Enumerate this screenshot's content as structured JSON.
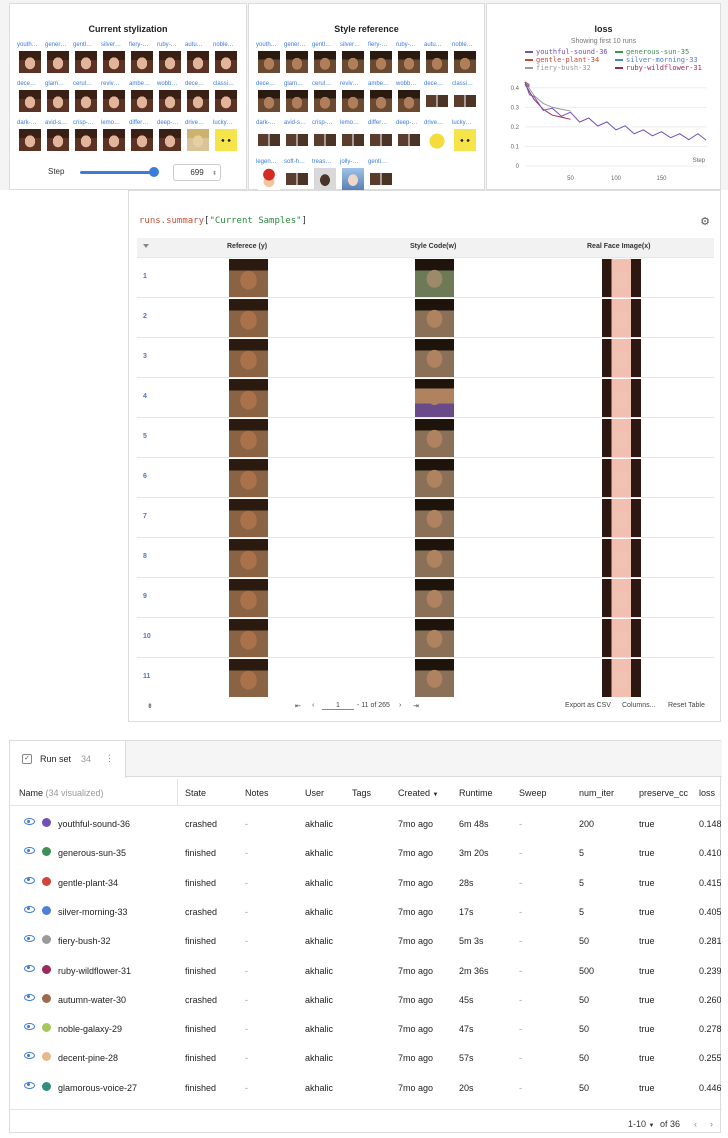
{
  "stylization_panel": {
    "title": "Current stylization",
    "thumb_captions": [
      "youth…",
      "gener…",
      "gentl…",
      "silver…",
      "fiery-…",
      "ruby-…",
      "autu…",
      "noble…",
      "dece…",
      "glam…",
      "cerul…",
      "reviv…",
      "ambe…",
      "wobb…",
      "dece…",
      "classi…",
      "dark-…",
      "avid-s…",
      "crisp-…",
      "lemo…",
      "differ…",
      "deep-…",
      "drive…",
      "lucky…"
    ],
    "step_label": "Step",
    "step_value": "699",
    "step_fraction": 0.92
  },
  "style_ref_panel": {
    "title": "Style reference",
    "thumb_captions": [
      "youth…",
      "gener…",
      "gentl…",
      "silver…",
      "fiery-…",
      "ruby-…",
      "autu…",
      "noble…",
      "dece…",
      "glam…",
      "cerul…",
      "reviv…",
      "ambe…",
      "wobb…",
      "dece…",
      "classi…",
      "dark-…",
      "avid-s…",
      "crisp-…",
      "lemo…",
      "differ…",
      "deep-…",
      "drive…",
      "lucky…",
      "legen…",
      "soft-h…",
      "treas…",
      "jolly-…",
      "genti…"
    ]
  },
  "loss_panel": {
    "title": "loss",
    "subtitle": "Showing first 10 runs",
    "legend": [
      {
        "name": "youthful-sound-36",
        "color": "#6f52b8"
      },
      {
        "name": "generous-sun-35",
        "color": "#3f8f56"
      },
      {
        "name": "gentle-plant-34",
        "color": "#d0443a"
      },
      {
        "name": "silver-morning-33",
        "color": "#4f7fd6"
      },
      {
        "name": "fiery-bush-32",
        "color": "#9a9a9a"
      },
      {
        "name": "ruby-wildflower-31",
        "color": "#9b2a5a"
      }
    ]
  },
  "chart_data": {
    "type": "line",
    "title": "loss",
    "xlabel": "Step",
    "ylabel": "",
    "xlim": [
      0,
      200
    ],
    "ylim": [
      0,
      0.45
    ],
    "x_ticks": [
      50,
      100,
      150
    ],
    "y_ticks": [
      0,
      0.1,
      0.2,
      0.3,
      0.4
    ],
    "series": [
      {
        "name": "youthful-sound-36",
        "x": [
          0,
          5,
          10,
          20,
          30,
          40,
          50,
          60,
          70,
          80,
          90,
          100,
          110,
          120,
          130,
          140,
          150,
          160,
          170,
          180,
          190,
          199
        ],
        "values": [
          0.43,
          0.38,
          0.34,
          0.3,
          0.28,
          0.27,
          0.26,
          0.24,
          0.23,
          0.22,
          0.21,
          0.2,
          0.19,
          0.18,
          0.17,
          0.17,
          0.16,
          0.16,
          0.15,
          0.15,
          0.15,
          0.148
        ]
      },
      {
        "name": "generous-sun-35",
        "x": [
          0,
          5
        ],
        "values": [
          0.42,
          0.41
        ]
      },
      {
        "name": "gentle-plant-34",
        "x": [
          0,
          5
        ],
        "values": [
          0.43,
          0.415
        ]
      },
      {
        "name": "silver-morning-33",
        "x": [
          0,
          5
        ],
        "values": [
          0.41,
          0.405
        ]
      },
      {
        "name": "fiery-bush-32",
        "x": [
          0,
          10,
          20,
          30,
          40,
          50
        ],
        "values": [
          0.43,
          0.36,
          0.32,
          0.3,
          0.29,
          0.281
        ]
      },
      {
        "name": "ruby-wildflower-31",
        "x": [
          0,
          10,
          20,
          30,
          40,
          50
        ],
        "values": [
          0.42,
          0.34,
          0.29,
          0.26,
          0.25,
          0.239
        ]
      }
    ]
  },
  "samples_table": {
    "query_key": "runs.summary",
    "query_open": "[",
    "query_str": "\"Current Samples\"",
    "query_close": "]",
    "columns": [
      "Referece (y)",
      "Style Code(w)",
      "Real Face Image(x)"
    ],
    "row_numbers": [
      "1",
      "2",
      "3",
      "4",
      "5",
      "6",
      "7",
      "8",
      "9",
      "10",
      "11"
    ],
    "footer": {
      "first": "⇤",
      "prev": "‹",
      "page": "1",
      "range": "- 11 of 265",
      "next": "›",
      "last": "⇥",
      "export": "Export as CSV",
      "columns": "Columns...",
      "reset": "Reset Table",
      "left_icon": "⇟"
    }
  },
  "runs": {
    "tab_label": "Run set",
    "tab_count": "34",
    "headers": {
      "name": "Name",
      "name_note": "(34 visualized)",
      "state": "State",
      "notes": "Notes",
      "user": "User",
      "tags": "Tags",
      "created": "Created",
      "runtime": "Runtime",
      "sweep": "Sweep",
      "num_iter": "num_iter",
      "preserve": "preserve_cc",
      "loss": "loss"
    },
    "rows": [
      {
        "name": "youthful-sound-36",
        "color": "#6f52b8",
        "state": "crashed",
        "notes": "-",
        "user": "akhalic",
        "created": "7mo ago",
        "runtime": "6m 48s",
        "sweep": "-",
        "num_iter": "200",
        "preserve": "true",
        "loss": "0.148"
      },
      {
        "name": "generous-sun-35",
        "color": "#3f8f56",
        "state": "finished",
        "notes": "-",
        "user": "akhalic",
        "created": "7mo ago",
        "runtime": "3m 20s",
        "sweep": "-",
        "num_iter": "5",
        "preserve": "true",
        "loss": "0.410"
      },
      {
        "name": "gentle-plant-34",
        "color": "#d0443a",
        "state": "finished",
        "notes": "-",
        "user": "akhalic",
        "created": "7mo ago",
        "runtime": "28s",
        "sweep": "-",
        "num_iter": "5",
        "preserve": "true",
        "loss": "0.415"
      },
      {
        "name": "silver-morning-33",
        "color": "#4f7fd6",
        "state": "crashed",
        "notes": "-",
        "user": "akhalic",
        "created": "7mo ago",
        "runtime": "17s",
        "sweep": "-",
        "num_iter": "5",
        "preserve": "true",
        "loss": "0.405"
      },
      {
        "name": "fiery-bush-32",
        "color": "#9a9a9a",
        "state": "finished",
        "notes": "-",
        "user": "akhalic",
        "created": "7mo ago",
        "runtime": "5m 3s",
        "sweep": "-",
        "num_iter": "50",
        "preserve": "true",
        "loss": "0.281"
      },
      {
        "name": "ruby-wildflower-31",
        "color": "#9b2a5a",
        "state": "finished",
        "notes": "-",
        "user": "akhalic",
        "created": "7mo ago",
        "runtime": "2m 36s",
        "sweep": "-",
        "num_iter": "500",
        "preserve": "true",
        "loss": "0.239"
      },
      {
        "name": "autumn-water-30",
        "color": "#9b6a4f",
        "state": "crashed",
        "notes": "-",
        "user": "akhalic",
        "created": "7mo ago",
        "runtime": "45s",
        "sweep": "-",
        "num_iter": "50",
        "preserve": "true",
        "loss": "0.260"
      },
      {
        "name": "noble-galaxy-29",
        "color": "#a8c75a",
        "state": "finished",
        "notes": "-",
        "user": "akhalic",
        "created": "7mo ago",
        "runtime": "47s",
        "sweep": "-",
        "num_iter": "50",
        "preserve": "true",
        "loss": "0.278"
      },
      {
        "name": "decent-pine-28",
        "color": "#e8b88f",
        "state": "finished",
        "notes": "-",
        "user": "akhalic",
        "created": "7mo ago",
        "runtime": "57s",
        "sweep": "-",
        "num_iter": "50",
        "preserve": "true",
        "loss": "0.255"
      },
      {
        "name": "glamorous-voice-27",
        "color": "#2f8f7a",
        "state": "finished",
        "notes": "-",
        "user": "akhalic",
        "created": "7mo ago",
        "runtime": "20s",
        "sweep": "-",
        "num_iter": "50",
        "preserve": "true",
        "loss": "0.446"
      }
    ],
    "pager": {
      "range": "1-10",
      "of": "of 36",
      "prev": "‹",
      "next": "›"
    }
  }
}
